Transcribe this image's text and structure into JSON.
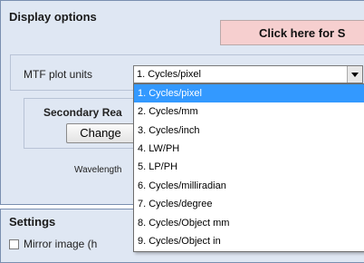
{
  "display_options": {
    "title": "Display options",
    "click_button": "Click here for S",
    "mtf_label": "MTF plot units",
    "selected_value": "1. Cycles/pixel",
    "secondary_title": "Secondary Rea",
    "change_button": "Change",
    "wavelength_label": "Wavelength"
  },
  "dropdown": {
    "options": [
      "1. Cycles/pixel",
      "2. Cycles/mm",
      "3. Cycles/inch",
      "4. LW/PH",
      "5. LP/PH",
      "6. Cycles/milliradian",
      "7. Cycles/degree",
      "8. Cycles/Object mm",
      "9. Cycles/Object in"
    ]
  },
  "settings": {
    "title": "Settings",
    "mirror_label": "Mirror image (h"
  }
}
